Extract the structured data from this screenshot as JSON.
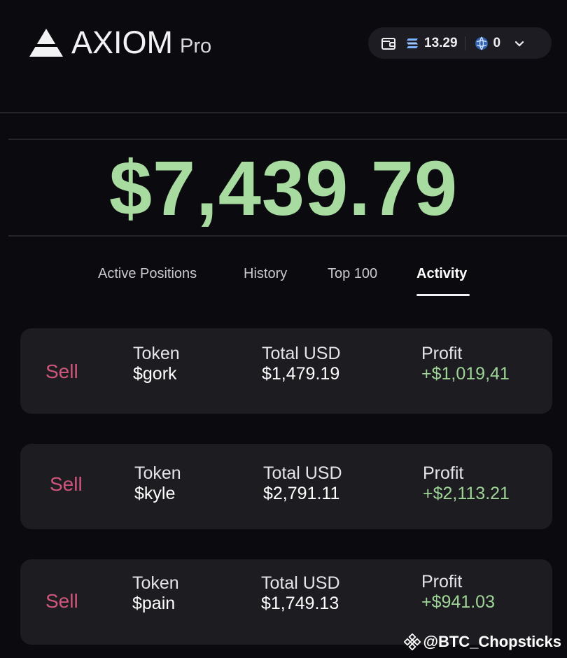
{
  "header": {
    "brand": "AXIOM",
    "brand_sub": "Pro",
    "wallet": {
      "sol_balance": "13.29",
      "points": "0"
    }
  },
  "portfolio": {
    "balance": "$7,439.79"
  },
  "tabs": [
    {
      "label": "Active Positions",
      "active": false
    },
    {
      "label": "History",
      "active": false
    },
    {
      "label": "Top 100",
      "active": false
    },
    {
      "label": "Activity",
      "active": true
    }
  ],
  "activity": {
    "columns": {
      "token": "Token",
      "total": "Total USD",
      "profit": "Profit"
    },
    "rows": [
      {
        "type": "Sell",
        "token": "$gork",
        "total_usd": "$1,479.19",
        "profit": "+$1,019,41"
      },
      {
        "type": "Sell",
        "token": "$kyle",
        "total_usd": "$2,791.11",
        "profit": "+$2,113.21"
      },
      {
        "type": "Sell",
        "token": "$pain",
        "total_usd": "$1,749.13",
        "profit": "+$941.03"
      }
    ]
  },
  "watermark": {
    "text": "@BTC_Chopsticks"
  },
  "colors": {
    "balance": "#a7dba0",
    "sell": "#d0557a",
    "profit": "#9fd497",
    "card_bg": "#1c1c21",
    "page_bg": "#0b0b0f"
  },
  "icons": [
    "axiom-logo-icon",
    "wallet-icon",
    "solana-icon",
    "globe-points-icon",
    "chevron-down-icon",
    "binance-icon"
  ]
}
